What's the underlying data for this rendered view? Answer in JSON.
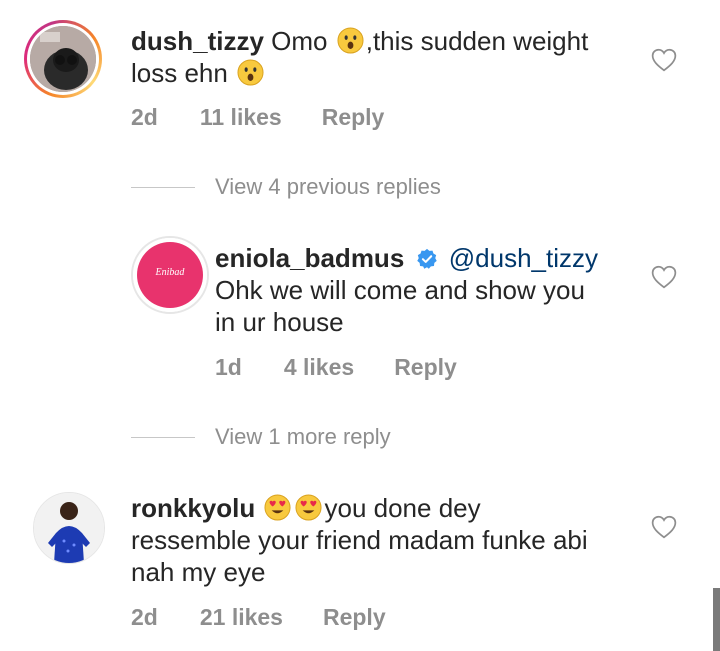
{
  "comments": [
    {
      "username": "dush_tizzy",
      "text_part1": "Omo",
      "text_part2": ",this sudden weight",
      "text_line2": "loss ehn",
      "age": "2d",
      "likes": "11 likes",
      "reply": "Reply"
    },
    {
      "username": "eniola_badmus",
      "mention": "@dush_tizzy",
      "text_line1": "Ohk we will come and show you",
      "text_line2": "in ur house",
      "age": "1d",
      "likes": "4 likes",
      "reply": "Reply",
      "avatar_logo": "Enibad"
    },
    {
      "username": "ronkkyolu",
      "text_part1": "you done dey",
      "text_line2": "ressemble your friend madam funke abi",
      "text_line3": "nah my eye",
      "age": "2d",
      "likes": "21 likes",
      "reply": "Reply"
    }
  ],
  "view_previous": "View 4 previous replies",
  "view_more": "View 1 more reply",
  "colors": {
    "text": "#262626",
    "meta": "#8e8e8e",
    "verified": "#3897f0",
    "pink": "#e8336d"
  },
  "icons": [
    "heart-outline-icon",
    "verified-badge-icon",
    "hushed-face-emoji",
    "heart-eyes-emoji"
  ]
}
